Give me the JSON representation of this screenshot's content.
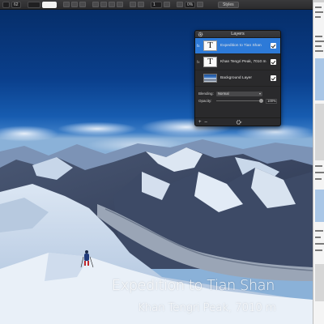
{
  "toolbar": {
    "font_size": "62",
    "line_height": "1",
    "tracking": "0%",
    "styles_label": "Styles"
  },
  "canvas": {
    "title_text": "Expedition to Tian Shan",
    "subtitle_text": "Khan Tengri  Peak, 7010 m"
  },
  "layers_panel": {
    "title": "Layers",
    "layers": [
      {
        "fx": "fx",
        "thumb": "T",
        "name": "Expedition to Tian Shan",
        "selected": true,
        "visible": true
      },
      {
        "fx": "fx",
        "thumb": "T",
        "name": "Khan Tengri  Peak, 7010 m",
        "selected": false,
        "visible": true
      },
      {
        "fx": "",
        "thumb": "image",
        "name": "Background Layer",
        "selected": false,
        "visible": true
      }
    ],
    "blending_label": "Blending:",
    "blending_value": "Normal",
    "opacity_label": "Opacity:",
    "opacity_value": "100%",
    "add_symbol": "+",
    "remove_symbol": "–"
  },
  "colors": {
    "selected_row": "#2d7ad8",
    "panel_bg": "#2a2a2c",
    "toolbar_bg": "#333335"
  }
}
